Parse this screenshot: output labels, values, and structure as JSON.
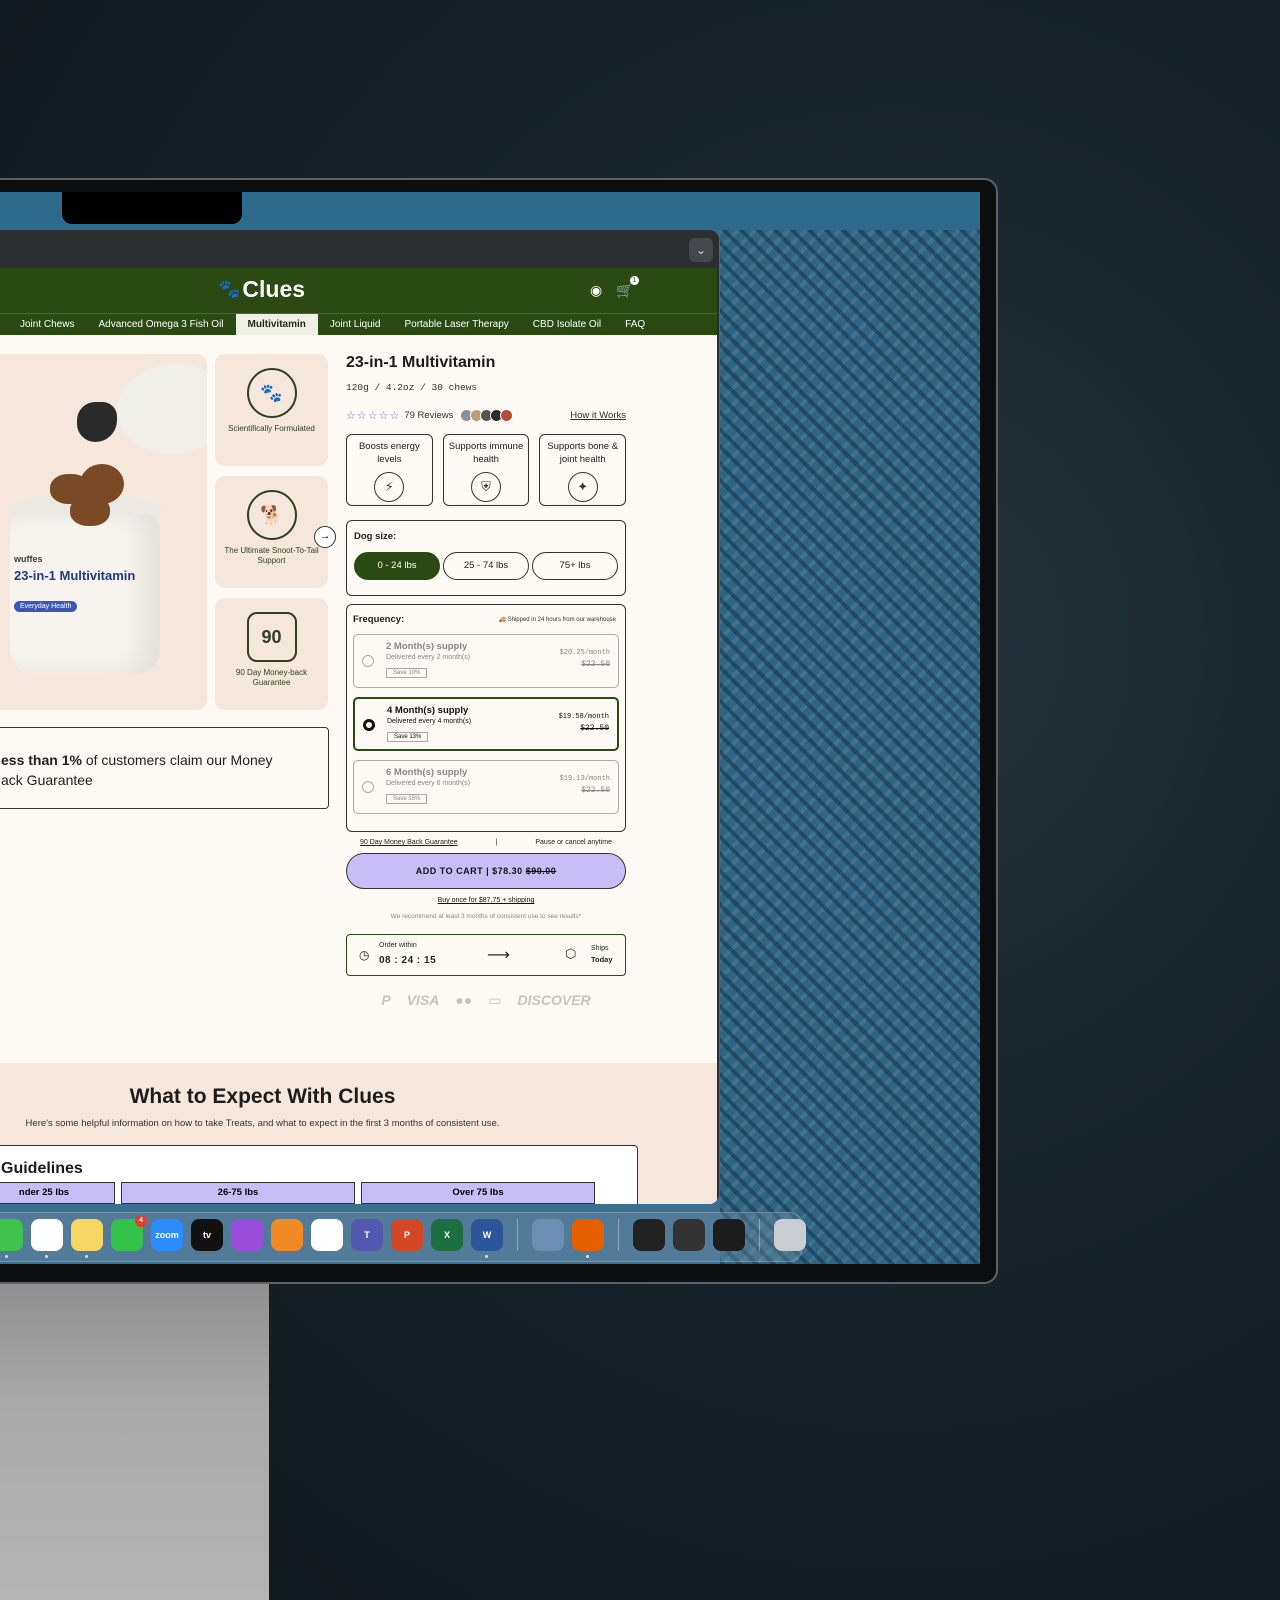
{
  "brand": {
    "name": "Clues",
    "cart_count": "1"
  },
  "nav": [
    "Joint Chews",
    "Advanced Omega 3 Fish Oil",
    "Multivitamin",
    "Joint Liquid",
    "Portable Laser Therapy",
    "CBD Isolate Oil",
    "FAQ"
  ],
  "nav_active": "Multivitamin",
  "gallery": {
    "jar_brand": "wuffes",
    "jar_title": "23-in-1 Multivitamin",
    "jar_pill": "Everyday Health",
    "features": [
      {
        "icon": "paw-seal-icon",
        "label": "Scientifically Formulated"
      },
      {
        "icon": "dog-jump-icon",
        "label": "The Ultimate Snoot-To-Tail Support"
      },
      {
        "icon": "calendar-90-icon",
        "number": "90",
        "label": "90 Day Money-back Guarantee"
      }
    ]
  },
  "claim": {
    "bold": "ess than 1%",
    "rest1": " of customers claim our Money",
    "line2": "ack Guarantee"
  },
  "product": {
    "title": "23-in-1 Multivitamin",
    "subtitle": "120g / 4.2oz / 30 chews",
    "stars": "☆☆☆☆☆",
    "reviews": "79 Reviews",
    "how_it_works": "How it Works",
    "benefits": [
      {
        "label": "Boosts energy levels",
        "icon": "energy-icon"
      },
      {
        "label": "Supports immune health",
        "icon": "shield-icon"
      },
      {
        "label": "Supports bone & joint health",
        "icon": "bone-icon"
      }
    ],
    "dog_size_label": "Dog size:",
    "sizes": [
      "0 - 24 lbs",
      "25 - 74 lbs",
      "75+ lbs"
    ],
    "frequency_label": "Frequency:",
    "ship_note": "Shipped in 24 hours from our warehouse",
    "options": [
      {
        "title": "2 Month(s) supply",
        "sub": "Delivered every 2 month(s)",
        "save": "Save 10%",
        "price": "$20.25/month",
        "old": "$22.50",
        "selected": false
      },
      {
        "title": "4 Month(s) supply",
        "sub": "Delivered every 4 month(s)",
        "save": "Save 13%",
        "price": "$19.58/month",
        "old": "$22.50",
        "selected": true
      },
      {
        "title": "6 Month(s) supply",
        "sub": "Delivered every 6 month(s)",
        "save": "Save 15%",
        "price": "$19.13/month",
        "old": "$22.50",
        "selected": false
      }
    ],
    "guarantee": "90 Day Money Back Guarantee",
    "pause": "Pause or cancel anytime",
    "atc_label": "ADD TO CART | $78.30",
    "atc_old": "$90.00",
    "buy_once": "Buy once for $87.75 + shipping",
    "recommend": "We recommend at least 3 months of consistent use to see results*",
    "order_within": "Order within",
    "timer": "08 : 24 : 15",
    "ships": "Ships",
    "today": "Today",
    "payments": [
      "P",
      "VISA",
      "●●",
      "▭",
      "DISCOVER"
    ]
  },
  "expect": {
    "title": "What to Expect With Clues",
    "subtitle": "Here's some helpful information on how to take Treats, and what to expect in the first 3 months of consistent use.",
    "guidelines": "Guidelines",
    "columns": [
      "nder 25 lbs",
      "26-75 lbs",
      "Over 75 lbs"
    ]
  },
  "dock": [
    {
      "name": "messages",
      "color": "#3fc24b",
      "label": "",
      "dot": true
    },
    {
      "name": "chatgpt",
      "color": "#ffffff",
      "label": "",
      "dot": true
    },
    {
      "name": "notes",
      "color": "#f5d563",
      "label": "",
      "dot": true
    },
    {
      "name": "facetime",
      "color": "#35c24b",
      "label": "",
      "badge": "4"
    },
    {
      "name": "zoom",
      "color": "#2d8cff",
      "label": "zoom"
    },
    {
      "name": "apple-tv",
      "color": "#111111",
      "label": "tv"
    },
    {
      "name": "podcasts",
      "color": "#9b4ddb",
      "label": ""
    },
    {
      "name": "books",
      "color": "#f08a24",
      "label": ""
    },
    {
      "name": "clickup",
      "color": "#ffffff",
      "label": ""
    },
    {
      "name": "teams",
      "color": "#5558af",
      "label": "T"
    },
    {
      "name": "powerpoint",
      "color": "#d24726",
      "label": "P"
    },
    {
      "name": "excel",
      "color": "#1d6f42",
      "label": "X"
    },
    {
      "name": "word",
      "color": "#2b579a",
      "label": "W",
      "dot": true
    },
    {
      "name": "preview",
      "color": "#6c8fb5",
      "label": ""
    },
    {
      "name": "firefox",
      "color": "#e66000",
      "label": "",
      "dot": true
    },
    {
      "name": "window-1",
      "color": "#222222",
      "label": ""
    },
    {
      "name": "window-2",
      "color": "#333333",
      "label": ""
    },
    {
      "name": "window-3",
      "color": "#1d1d1d",
      "label": ""
    },
    {
      "name": "trash",
      "color": "#c9cdd1",
      "label": ""
    }
  ]
}
